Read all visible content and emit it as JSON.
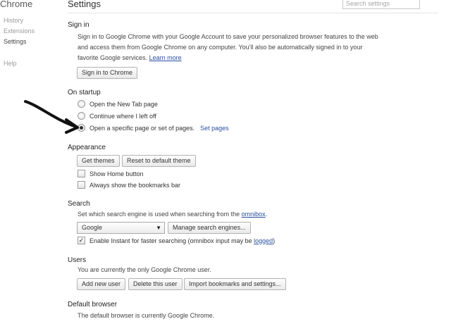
{
  "sidebar": {
    "brand": "Chrome",
    "items": [
      {
        "label": "History"
      },
      {
        "label": "Extensions"
      },
      {
        "label": "Settings"
      },
      {
        "label": "Help"
      }
    ]
  },
  "header": {
    "title": "Settings",
    "search_placeholder": "Search settings"
  },
  "signin": {
    "title": "Sign in",
    "desc_line1": "Sign in to Google Chrome with your Google Account to save your personalized browser features to the web",
    "desc_line2": "and access them from Google Chrome on any computer. You'll also be automatically signed in to your",
    "desc_line3": "favorite Google services.",
    "learn_more": "Learn more",
    "button": "Sign in to Chrome"
  },
  "startup": {
    "title": "On startup",
    "options": [
      {
        "label": "Open the New Tab page",
        "selected": false
      },
      {
        "label": "Continue where I left off",
        "selected": false
      },
      {
        "label": "Open a specific page or set of pages.",
        "selected": true
      }
    ],
    "set_pages": "Set pages"
  },
  "appearance": {
    "title": "Appearance",
    "get_themes": "Get themes",
    "reset_theme": "Reset to default theme",
    "show_home": {
      "label": "Show Home button",
      "checked": false
    },
    "bookmarks_bar": {
      "label": "Always show the bookmarks bar",
      "checked": false
    }
  },
  "search": {
    "title": "Search",
    "desc_prefix": "Set which search engine is used when searching from the ",
    "omnibox": "omnibox",
    "desc_suffix": ".",
    "engine": "Google",
    "manage": "Manage search engines...",
    "instant_prefix": "Enable Instant for faster searching (omnibox input may be ",
    "logged": "logged",
    "instant_suffix": ")",
    "instant_checked": true
  },
  "users": {
    "title": "Users",
    "desc": "You are currently the only Google Chrome user.",
    "add": "Add new user",
    "delete": "Delete this user",
    "import": "Import bookmarks and settings..."
  },
  "default_browser": {
    "title": "Default browser",
    "desc": "The default browser is currently Google Chrome."
  },
  "colors": {
    "link": "#2a4fa0",
    "annotation_arrow": "#111111"
  }
}
